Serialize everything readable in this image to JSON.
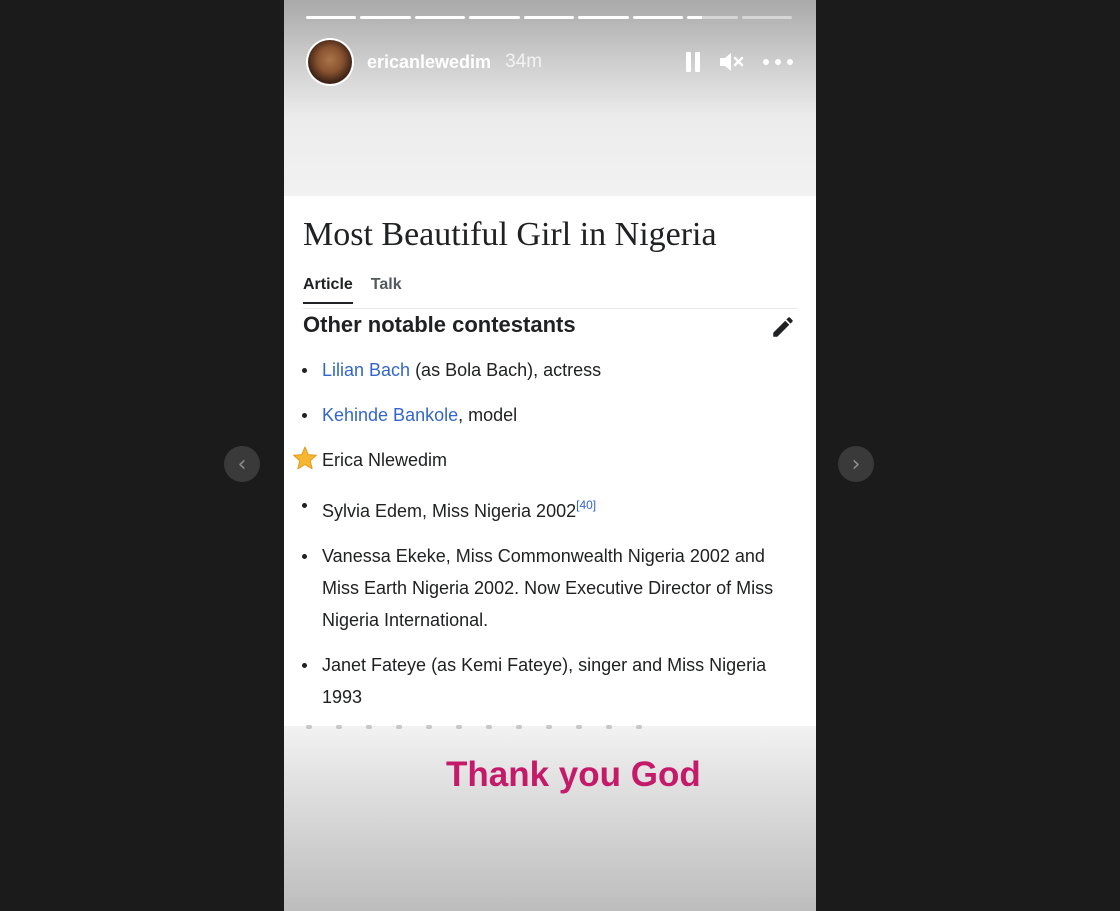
{
  "navigation": {
    "prev_icon": "chevron-left-icon",
    "next_icon": "chevron-right-icon"
  },
  "story": {
    "progress": [
      {
        "fill": 1.0
      },
      {
        "fill": 1.0
      },
      {
        "fill": 1.0
      },
      {
        "fill": 1.0
      },
      {
        "fill": 1.0
      },
      {
        "fill": 1.0
      },
      {
        "fill": 1.0
      },
      {
        "fill": 0.3
      },
      {
        "fill": 0.0
      }
    ],
    "username": "ericanlewedim",
    "time": "34m",
    "controls": {
      "pause_icon": "pause-icon",
      "mute_icon": "speaker-muted-icon",
      "more_icon": "more-options-icon"
    },
    "caption": "Thank you God",
    "caption_color": "#c41a69"
  },
  "wiki": {
    "title": "Most Beautiful Girl in Nigeria",
    "tabs": [
      {
        "label": "Article",
        "active": true
      },
      {
        "label": "Talk",
        "active": false
      }
    ],
    "section_heading": "Other notable contestants",
    "link_color": "#3366cc",
    "items": [
      {
        "link": "Lilian Bach",
        "text": " (as Bola Bach), actress"
      },
      {
        "link": "Kehinde Bankole",
        "text": ", model"
      },
      {
        "text": "Erica Nlewedim",
        "marker": "star-icon"
      },
      {
        "text": "Sylvia Edem, Miss Nigeria 2002",
        "ref": "[40]"
      },
      {
        "text": "Vanessa Ekeke, Miss Commonwealth Nigeria 2002 and Miss Earth Nigeria 2002. Now Executive Director of Miss Nigeria International."
      },
      {
        "text": "Janet Fateye (as Kemi Fateye), singer and Miss Nigeria 1993"
      }
    ]
  }
}
